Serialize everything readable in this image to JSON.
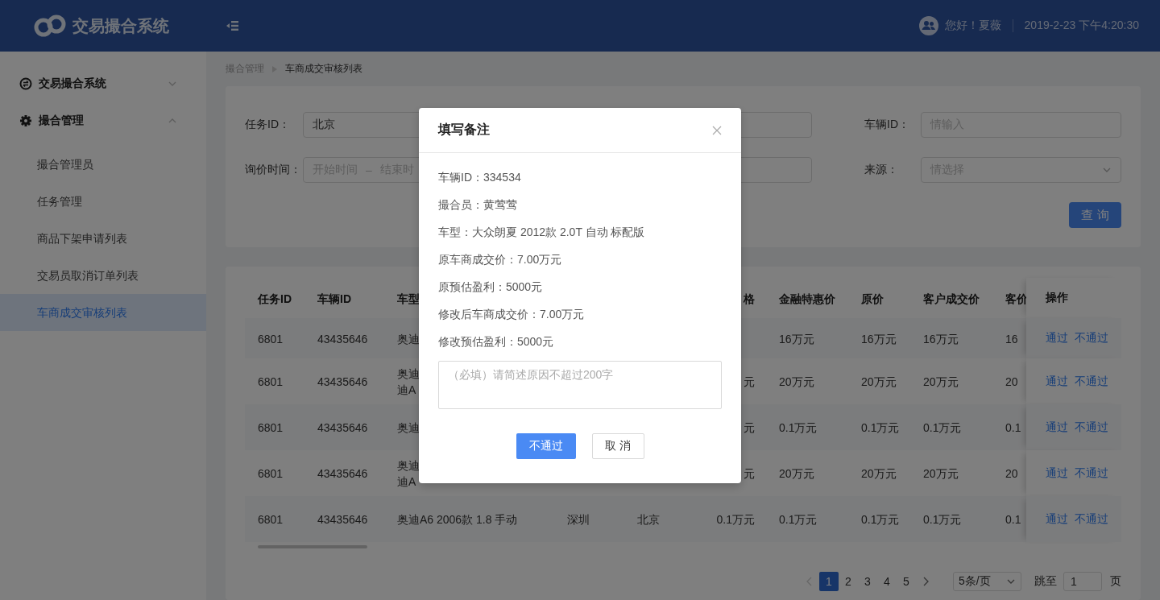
{
  "header": {
    "title": "交易撮合系统",
    "greeting": "您好！夏薇",
    "datetime": "2019-2-23 下午4:20:30"
  },
  "sidebar": {
    "items": [
      {
        "label": "交易撮合系统",
        "expanded": false
      },
      {
        "label": "撮合管理",
        "expanded": true,
        "children": [
          {
            "label": "撮合管理员",
            "selected": false
          },
          {
            "label": "任务管理",
            "selected": false
          },
          {
            "label": "商品下架申请列表",
            "selected": false
          },
          {
            "label": "交易员取消订单列表",
            "selected": false
          },
          {
            "label": "车商成交审核列表",
            "selected": true
          }
        ]
      }
    ]
  },
  "breadcrumb": [
    "撮合管理",
    "车商成交审核列表"
  ],
  "filters": {
    "fields": [
      {
        "kind": "text",
        "label": "任务ID：",
        "value": "北京"
      },
      {
        "kind": "text",
        "label": "车辆ID：",
        "placeholder": "情输入"
      },
      {
        "kind": "daterange",
        "label": "询价时间：",
        "start_placeholder": "开始时间",
        "separator": "–",
        "end_placeholder": "结束时"
      },
      {
        "kind": "select",
        "label": "来源：",
        "placeholder": "情选择"
      }
    ],
    "search_button": "查 询"
  },
  "table": {
    "columns": [
      "任务ID",
      "车辆ID",
      "车型",
      "",
      "",
      "格",
      "金融特惠价",
      "原价",
      "客户成交价",
      "客价"
    ],
    "action_header": "操作",
    "rows": [
      {
        "cells": [
          "6801",
          "43435646",
          "奥迪",
          "",
          "",
          "",
          "16万元",
          "16万元",
          "16万元",
          "16"
        ],
        "actions": [
          "通过",
          "不通过"
        ]
      },
      {
        "cells": [
          "6801",
          "43435646",
          "奥迪迪A",
          "",
          "",
          "元",
          "20万元",
          "20万元",
          "20万元",
          "20"
        ],
        "actions": [
          "通过",
          "不通过"
        ]
      },
      {
        "cells": [
          "6801",
          "43435646",
          "奥迪",
          "",
          "",
          "元",
          "0.1万元",
          "0.1万元",
          "0.1万元",
          "0.1"
        ],
        "actions": [
          "通过",
          "不通过"
        ]
      },
      {
        "cells": [
          "6801",
          "43435646",
          "奥迪迪A",
          "",
          "",
          "元",
          "20万元",
          "20万元",
          "20万元",
          "20"
        ],
        "actions": [
          "通过",
          "不通过"
        ]
      },
      {
        "cells": [
          "6801",
          "43435646",
          "奥迪A6 2006款 1.8 手动",
          "深圳",
          "北京",
          "0.1万元",
          "0.1万元",
          "0.1万元",
          "0.1万元",
          "0.1"
        ],
        "actions": [
          "通过",
          "不通过"
        ]
      }
    ]
  },
  "pagination": {
    "pages": [
      {
        "label": "1",
        "selected": true
      },
      {
        "label": "2",
        "selected": false
      },
      {
        "label": "3",
        "selected": false
      },
      {
        "label": "4",
        "selected": false
      },
      {
        "label": "5",
        "selected": false
      }
    ],
    "page_size": "5条/页",
    "jump_label": "跳至",
    "jump_value": "1",
    "jump_suffix": "页"
  },
  "dialog": {
    "title": "填写备注",
    "lines": [
      "车辆ID：334534",
      "撮合员：黄莺莺",
      "车型：大众朗夏 2012款 2.0T 自动 标配版",
      "原车商成交价：7.00万元",
      "原预估盈利：5000元",
      "修改后车商成交价：7.00万元",
      "修改预估盈利：5000元"
    ],
    "placeholder": "（必填）请简述原因不超过200字",
    "buttons": [
      {
        "label": "不通过",
        "kind": "primary"
      },
      {
        "label": "取 消",
        "kind": "default"
      }
    ]
  }
}
